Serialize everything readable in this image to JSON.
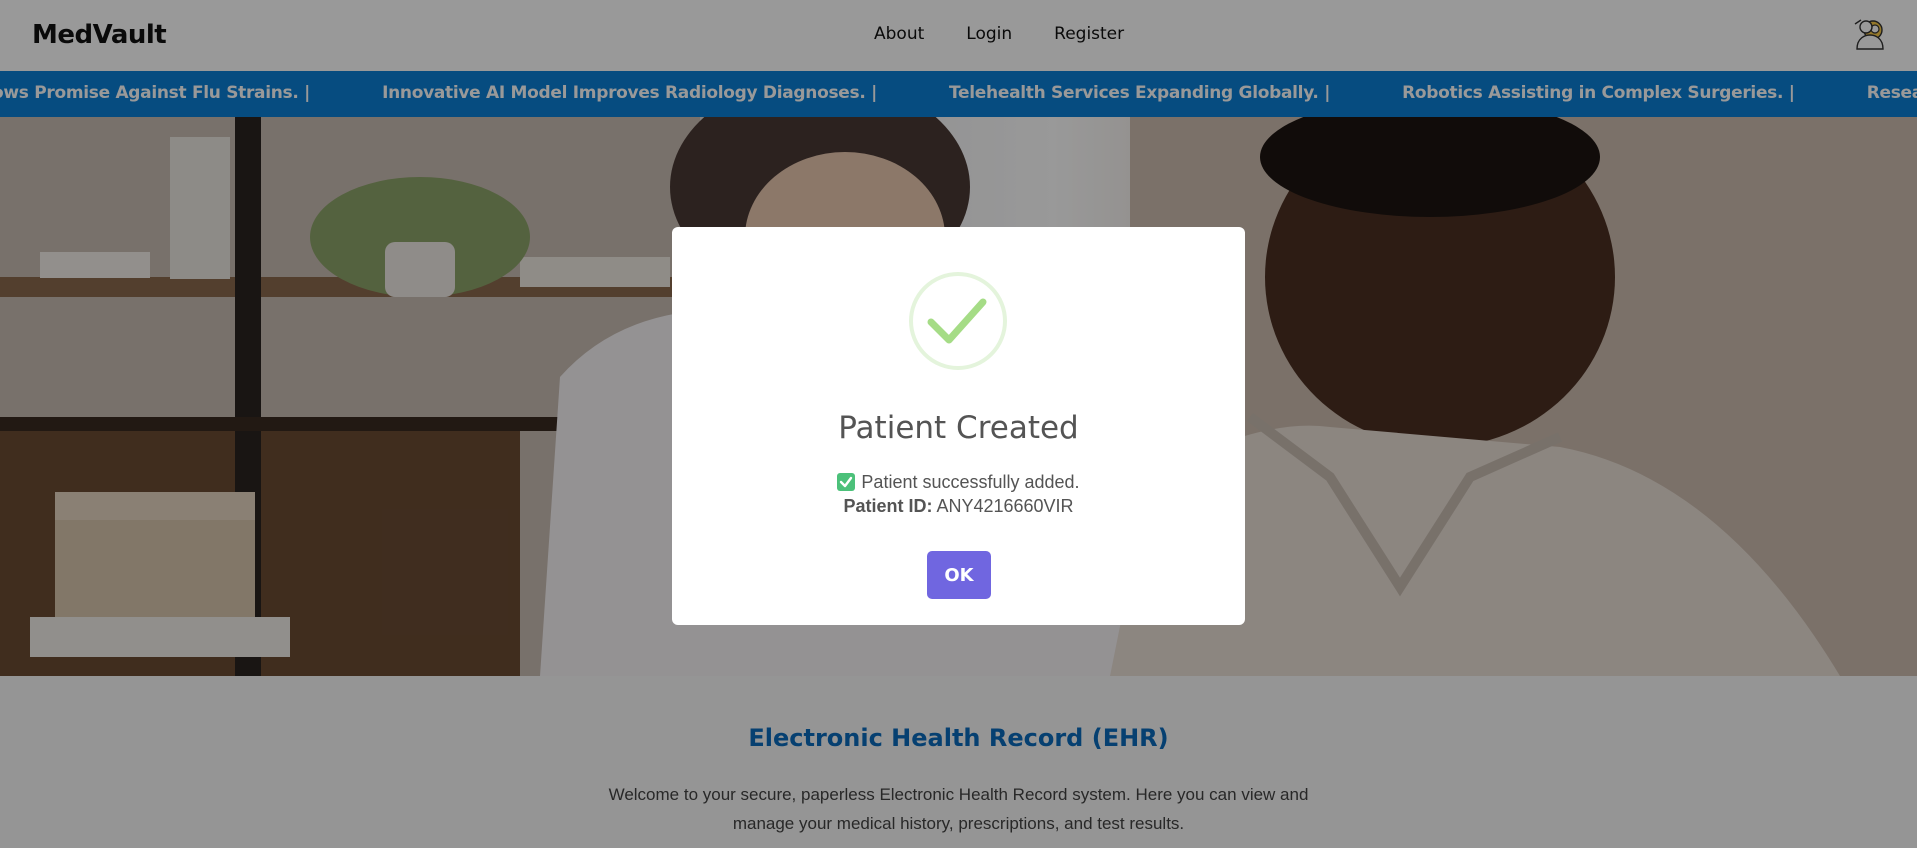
{
  "header": {
    "brand": "MedVault",
    "nav": [
      {
        "label": "About"
      },
      {
        "label": "Login"
      },
      {
        "label": "Register"
      }
    ],
    "user_icon": "doctor-avatar-icon"
  },
  "ticker": {
    "items": [
      "ows Promise Against Flu Strains.  |",
      "Innovative AI Model Improves Radiology Diagnoses.  |",
      "Telehealth Services Expanding Globally.  |",
      "Robotics Assisting in Complex Surgeries.  |",
      "Research Links Exercise to Red"
    ],
    "bg_color": "#0a7fd6"
  },
  "intro": {
    "title": "Electronic Health Record (EHR)",
    "text": "Welcome to your secure, paperless Electronic Health Record system. Here you can view and manage your medical history, prescriptions, and test results."
  },
  "modal": {
    "title": "Patient Created",
    "message": "Patient successfully added.",
    "id_label": "Patient ID:",
    "id_value": "ANY4216660VIR",
    "ok_label": "OK",
    "icon": "success-checkmark-icon",
    "button_color": "#7066e0"
  }
}
